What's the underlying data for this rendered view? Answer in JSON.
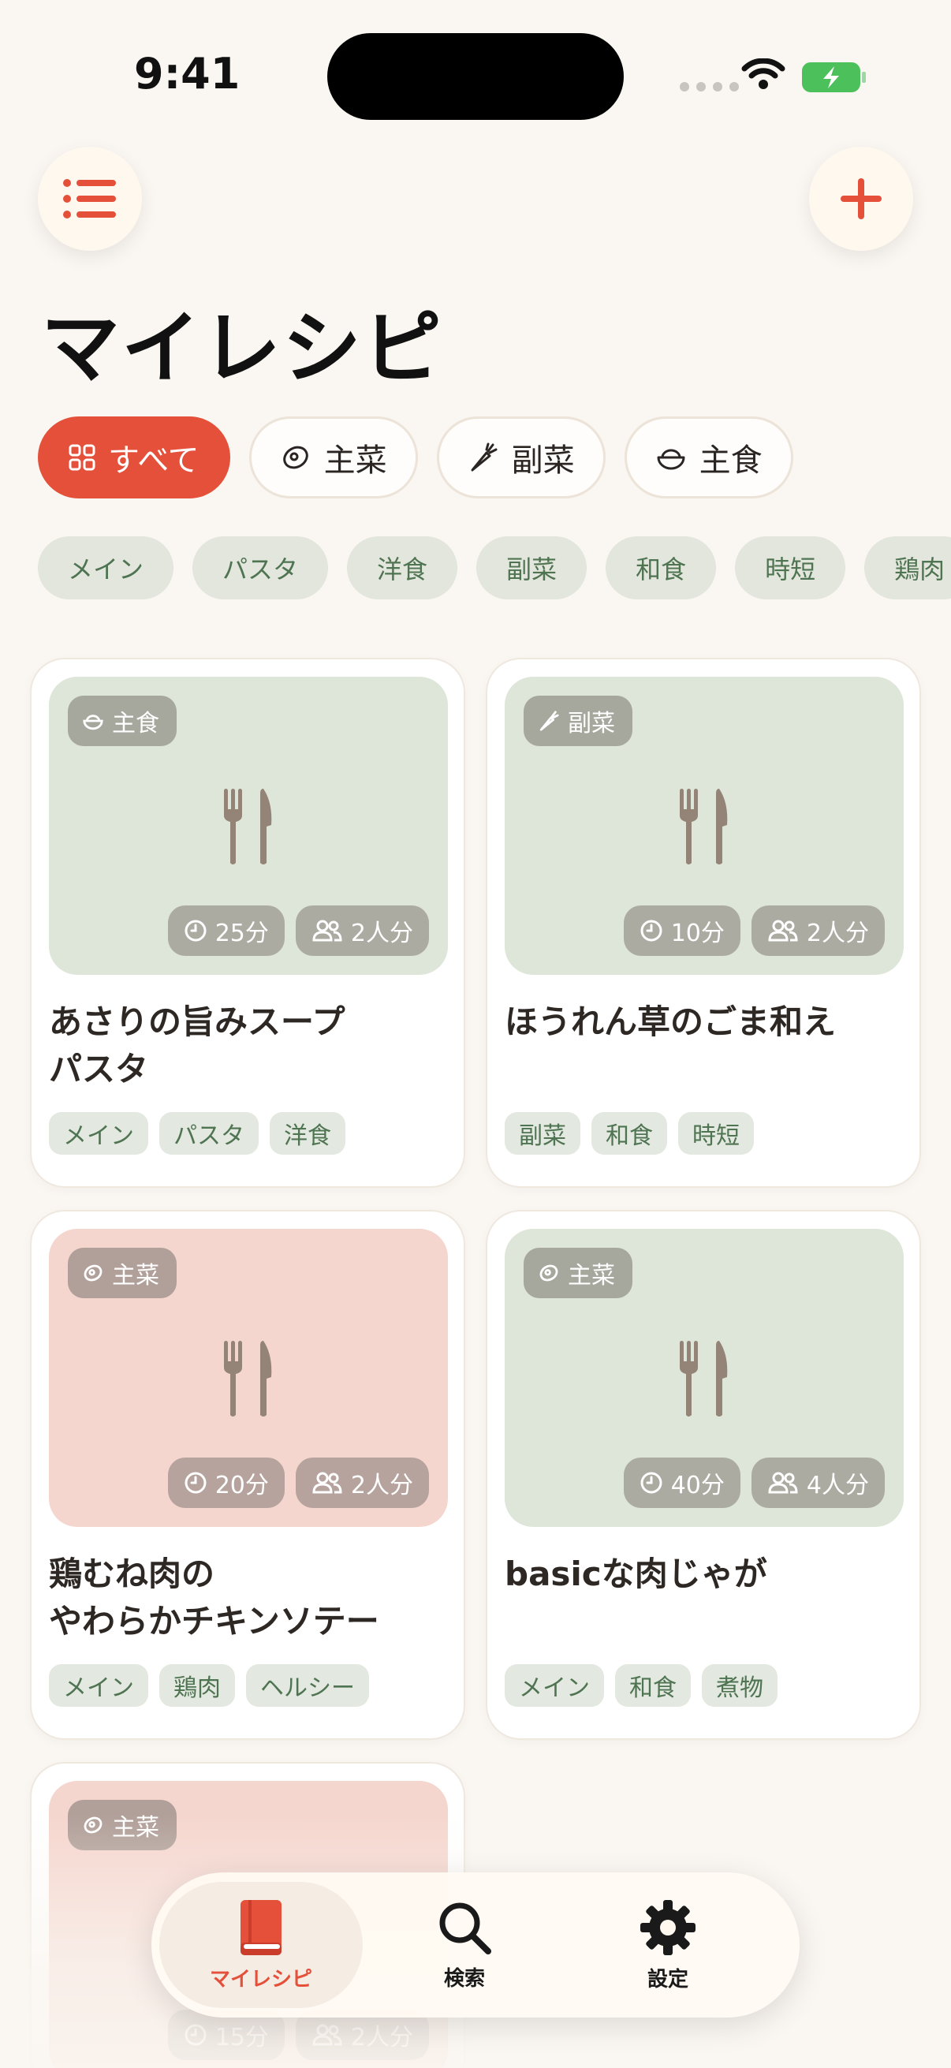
{
  "status_bar": {
    "time": "9:41"
  },
  "header": {
    "title": "マイレシピ"
  },
  "segments": [
    {
      "label": "すべて",
      "icon": "grid-icon",
      "active": true
    },
    {
      "label": "主菜",
      "icon": "meat-icon",
      "active": false
    },
    {
      "label": "副菜",
      "icon": "carrot-icon",
      "active": false
    },
    {
      "label": "主食",
      "icon": "rice-bowl-icon",
      "active": false
    }
  ],
  "tags": [
    "メイン",
    "パスタ",
    "洋食",
    "副菜",
    "和食",
    "時短",
    "鶏肉"
  ],
  "recipes": [
    {
      "category": "主食",
      "time": "25分",
      "servings": "2人分",
      "title": "あさりの旨みスープ\nパスタ",
      "tags": [
        "メイン",
        "パスタ",
        "洋食"
      ]
    },
    {
      "category": "副菜",
      "time": "10分",
      "servings": "2人分",
      "title": "ほうれん草のごま和え",
      "tags": [
        "副菜",
        "和食",
        "時短"
      ]
    },
    {
      "category": "主菜",
      "time": "20分",
      "servings": "2人分",
      "title": "鶏むね肉の\nやわらかチキンソテー",
      "tags": [
        "メイン",
        "鶏肉",
        "ヘルシー"
      ]
    },
    {
      "category": "主菜",
      "time": "40分",
      "servings": "4人分",
      "title": "basicな肉じゃが",
      "tags": [
        "メイン",
        "和食",
        "煮物"
      ]
    },
    {
      "category": "主菜",
      "time": "15分",
      "servings": "2人分"
    }
  ],
  "tab_bar": [
    {
      "label": "マイレシピ",
      "icon": "book-icon",
      "active": true
    },
    {
      "label": "検索",
      "icon": "search-icon",
      "active": false
    },
    {
      "label": "設定",
      "icon": "gear-icon",
      "active": false
    }
  ],
  "colors": {
    "accent": "#e4503a",
    "background": "#faf6f1",
    "tag_green": "#4f7451"
  }
}
